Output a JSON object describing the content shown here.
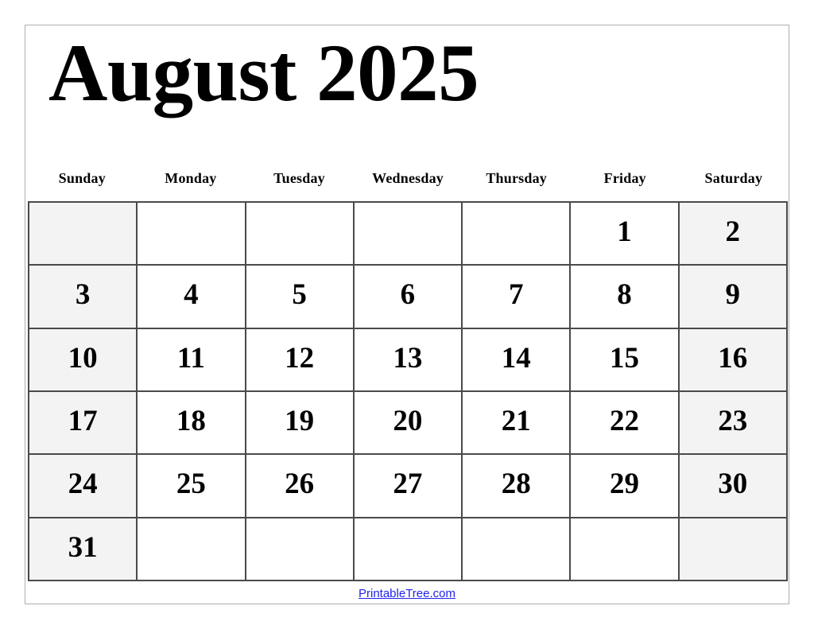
{
  "document": {
    "title": "August 2025",
    "month": "August",
    "year": "2025"
  },
  "weekdays": [
    {
      "label": "Sunday",
      "weekend": true
    },
    {
      "label": "Monday",
      "weekend": false
    },
    {
      "label": "Tuesday",
      "weekend": false
    },
    {
      "label": "Wednesday",
      "weekend": false
    },
    {
      "label": "Thursday",
      "weekend": false
    },
    {
      "label": "Friday",
      "weekend": false
    },
    {
      "label": "Saturday",
      "weekend": true
    }
  ],
  "weeks": [
    [
      "",
      "",
      "",
      "",
      "",
      "1",
      "2"
    ],
    [
      "3",
      "4",
      "5",
      "6",
      "7",
      "8",
      "9"
    ],
    [
      "10",
      "11",
      "12",
      "13",
      "14",
      "15",
      "16"
    ],
    [
      "17",
      "18",
      "19",
      "20",
      "21",
      "22",
      "23"
    ],
    [
      "24",
      "25",
      "26",
      "27",
      "28",
      "29",
      "30"
    ],
    [
      "31",
      "",
      "",
      "",
      "",
      "",
      ""
    ]
  ],
  "footer": {
    "link_text": "PrintableTree.com"
  },
  "colors": {
    "weekend_background": "#f3f3f3",
    "weekday_background": "#ffffff",
    "grid_line": "#4a4a4a",
    "page_border": "#aeaeae",
    "text": "#000000",
    "link": "#2222ee"
  }
}
